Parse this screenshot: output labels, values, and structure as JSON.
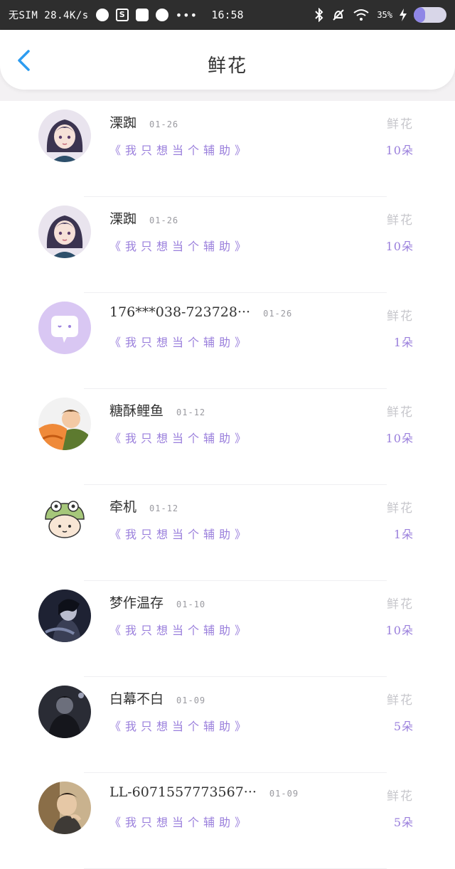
{
  "status_bar": {
    "carrier": "无SIM 28.4K/s",
    "time": "16:58",
    "battery_text": "35%",
    "battery_level": 0.35,
    "icons": [
      "browser-icon",
      "s-app-icon",
      "message-icon",
      "paint-icon",
      "more-dots-icon",
      "bluetooth-icon",
      "mute-icon",
      "wifi-icon",
      "charging-icon"
    ]
  },
  "nav": {
    "title": "鲜花",
    "back_icon": "chevron-left-icon",
    "accent": "#2d9cf0"
  },
  "colors": {
    "purple": "#9a7fdc",
    "gray": "#c7c7cc"
  },
  "items": [
    {
      "name": "溧踟",
      "date": "01-26",
      "sub": "《我只想当个辅助》",
      "gift": "鲜花",
      "count": "10朵",
      "avatar": "anime-girl-avatar"
    },
    {
      "name": "溧踟",
      "date": "01-26",
      "sub": "《我只想当个辅助》",
      "gift": "鲜花",
      "count": "10朵",
      "avatar": "anime-girl-avatar"
    },
    {
      "name": "176***038-723728···",
      "date": "01-26",
      "sub": "《我只想当个辅助》",
      "gift": "鲜花",
      "count": "1朵",
      "avatar": "chat-bubble-avatar"
    },
    {
      "name": "糖酥鲤鱼",
      "date": "01-12",
      "sub": "《我只想当个辅助》",
      "gift": "鲜花",
      "count": "10朵",
      "avatar": "cartoon-boy-avatar"
    },
    {
      "name": "牵机",
      "date": "01-12",
      "sub": "《我只想当个辅助》",
      "gift": "鲜花",
      "count": "1朵",
      "avatar": "frog-hat-avatar"
    },
    {
      "name": "梦作温存",
      "date": "01-10",
      "sub": "《我只想当个辅助》",
      "gift": "鲜花",
      "count": "10朵",
      "avatar": "dark-portrait-avatar"
    },
    {
      "name": "白幕不白",
      "date": "01-09",
      "sub": "《我只想当个辅助》",
      "gift": "鲜花",
      "count": "5朵",
      "avatar": "night-figure-avatar"
    },
    {
      "name": "LL-6071557773567···",
      "date": "01-09",
      "sub": "《我只想当个辅助》",
      "gift": "鲜花",
      "count": "5朵",
      "avatar": "man-portrait-avatar"
    }
  ]
}
